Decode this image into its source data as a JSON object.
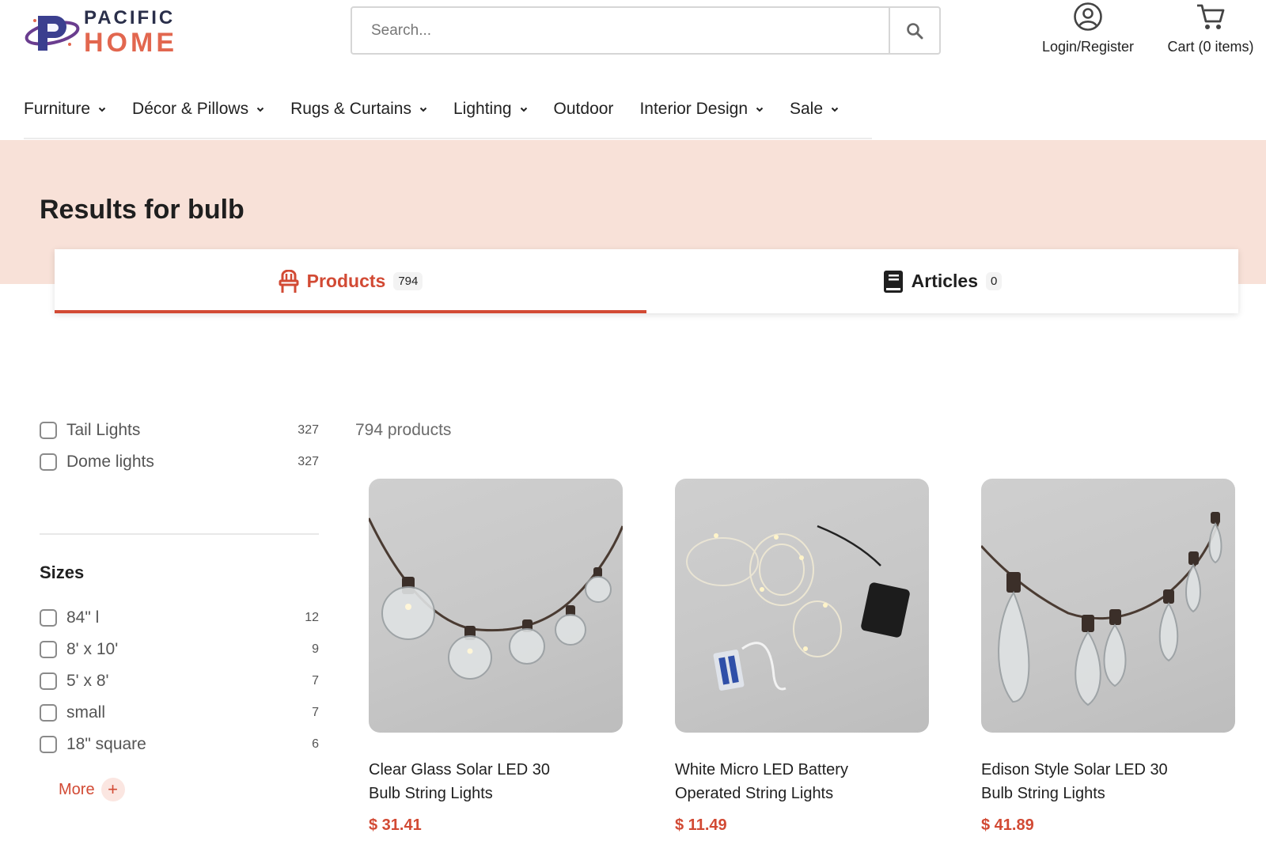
{
  "brand": {
    "line1": "PACIFIC",
    "line2": "HOME"
  },
  "search": {
    "placeholder": "Search..."
  },
  "header": {
    "account_label": "Login/Register",
    "cart_label": "Cart (0 items)"
  },
  "nav": [
    {
      "label": "Furniture",
      "dropdown": true
    },
    {
      "label": "Décor & Pillows",
      "dropdown": true
    },
    {
      "label": "Rugs & Curtains",
      "dropdown": true
    },
    {
      "label": "Lighting",
      "dropdown": true
    },
    {
      "label": "Outdoor",
      "dropdown": false
    },
    {
      "label": "Interior Design",
      "dropdown": true
    },
    {
      "label": "Sale",
      "dropdown": true
    }
  ],
  "results": {
    "prefix": "Results for",
    "query": "bulb"
  },
  "tabs": [
    {
      "label": "Products",
      "count": "794",
      "active": true,
      "icon": "chair-icon"
    },
    {
      "label": "Articles",
      "count": "0",
      "active": false,
      "icon": "book-icon"
    }
  ],
  "filters": {
    "type_facets": [
      {
        "label": "Tail Lights",
        "count": "327",
        "checked": false
      },
      {
        "label": "Dome lights",
        "count": "327",
        "checked": false
      }
    ],
    "sizes_title": "Sizes",
    "size_facets": [
      {
        "label": "84\" l",
        "count": "12",
        "checked": false
      },
      {
        "label": "8' x 10'",
        "count": "9",
        "checked": false
      },
      {
        "label": "5' x 8'",
        "count": "7",
        "checked": false
      },
      {
        "label": "small",
        "count": "7",
        "checked": false
      },
      {
        "label": "18\" square",
        "count": "6",
        "checked": false
      }
    ],
    "more_label": "More",
    "more_icon": "+"
  },
  "product_count_label": "794 products",
  "products": [
    {
      "name": "Clear Glass Solar LED 30 Bulb String Lights",
      "price": "$ 31.41"
    },
    {
      "name": "White Micro LED Battery Operated String Lights",
      "price": "$ 11.49"
    },
    {
      "name": "Edison Style Solar LED 30 Bulb String Lights",
      "price": "$ 41.89"
    }
  ],
  "colors": {
    "accent": "#d24a34",
    "band": "#f8e1d8",
    "brand_navy": "#2a2f4a",
    "brand_orange": "#e2674f"
  }
}
